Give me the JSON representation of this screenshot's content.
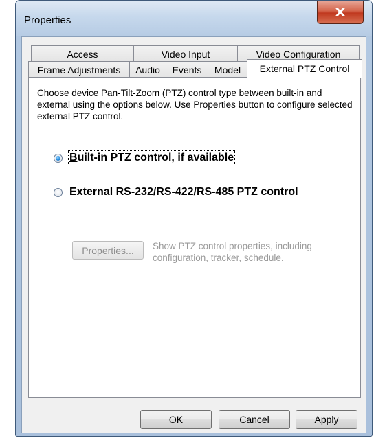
{
  "window": {
    "title": "Properties",
    "close_icon": "close-x-icon"
  },
  "tabs": {
    "back_row": [
      {
        "label": "Access"
      },
      {
        "label": "Video Input"
      },
      {
        "label": "Video Configuration"
      }
    ],
    "front_row": [
      {
        "label": "Frame Adjustments"
      },
      {
        "label": "Audio"
      },
      {
        "label": "Events"
      },
      {
        "label": "Model"
      },
      {
        "label": "External PTZ Control",
        "active": true
      }
    ]
  },
  "panel": {
    "intro": "Choose device Pan-Tilt-Zoom (PTZ) control type between built-in and external using the options below. Use Properties button to configure selected external PTZ control.",
    "options": [
      {
        "label_prefix": "",
        "label_underlined": "B",
        "label_rest": "uilt-in PTZ control, if available",
        "selected": true
      },
      {
        "label_prefix": "E",
        "label_underlined": "x",
        "label_rest": "ternal RS-232/RS-422/RS-485 PTZ control",
        "selected": false
      }
    ],
    "properties_button": "Properties...",
    "properties_description": "Show PTZ control properties, including configuration, tracker, schedule."
  },
  "buttons": {
    "ok": "OK",
    "cancel": "Cancel",
    "apply_underlined": "A",
    "apply_rest": "pply"
  }
}
